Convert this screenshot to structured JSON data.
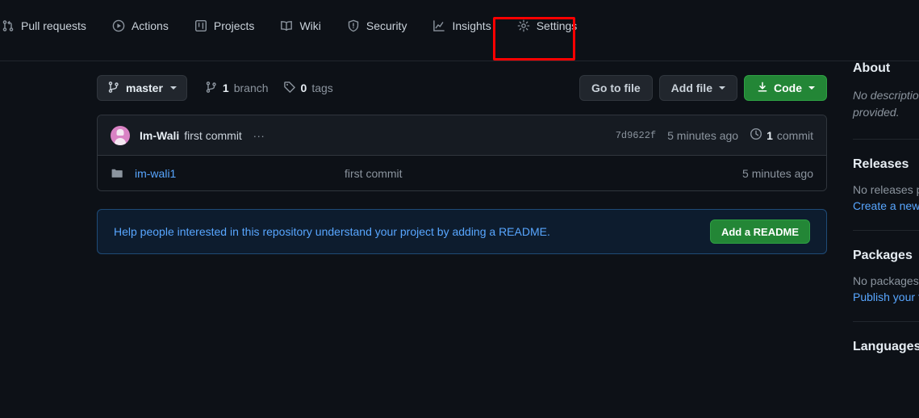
{
  "nav": {
    "tabs": [
      {
        "label": "Pull requests",
        "icon": "git-pull-request-icon",
        "selected": false
      },
      {
        "label": "Actions",
        "icon": "play-icon",
        "selected": false
      },
      {
        "label": "Projects",
        "icon": "project-board-icon",
        "selected": false
      },
      {
        "label": "Wiki",
        "icon": "book-icon",
        "selected": false
      },
      {
        "label": "Security",
        "icon": "shield-icon",
        "selected": false
      },
      {
        "label": "Insights",
        "icon": "graph-icon",
        "selected": false
      },
      {
        "label": "Settings",
        "icon": "gear-icon",
        "selected": false
      }
    ]
  },
  "annotation": {
    "target": "Settings",
    "color": "#fe0000"
  },
  "file_nav": {
    "branch_button": {
      "icon": "git-branch-icon",
      "name": "master",
      "caret": "chevron-down-icon"
    },
    "branch_count": {
      "count": "1",
      "label": "branch",
      "icon": "git-branch-icon"
    },
    "tag_count": {
      "count": "0",
      "label": "tags",
      "icon": "tag-icon"
    },
    "go_to_file": "Go to file",
    "add_file": "Add file",
    "code_button": "Code"
  },
  "commit_header": {
    "author": "Im-Wali",
    "message": "first commit",
    "ellipsis": "...",
    "sha": "7d9622f",
    "time": "5 minutes ago",
    "commit_count_number": "1",
    "commit_count_label": "commit",
    "history_icon": "history-icon",
    "avatar_color": "#d982c4"
  },
  "files": [
    {
      "icon": "folder-icon",
      "name": "im-wali1",
      "message": "first commit",
      "time": "5 minutes ago"
    }
  ],
  "readme_prompt": {
    "text": "Help people interested in this repository understand your project by adding a README.",
    "button": "Add a README"
  },
  "sidebar": {
    "about": {
      "title": "About",
      "description": "No description provided."
    },
    "releases": {
      "title": "Releases",
      "empty": "No releases published",
      "link": "Create a new release"
    },
    "packages": {
      "title": "Packages",
      "empty": "No packages published",
      "link": "Publish your first package"
    },
    "languages": {
      "title": "Languages"
    }
  },
  "colors": {
    "background": "#0d1117",
    "surface": "#161b22",
    "border": "#30363d",
    "accent_green": "#238636",
    "link_blue": "#58a6ff",
    "muted": "#8b949e",
    "annotation_red": "#fe0000"
  }
}
